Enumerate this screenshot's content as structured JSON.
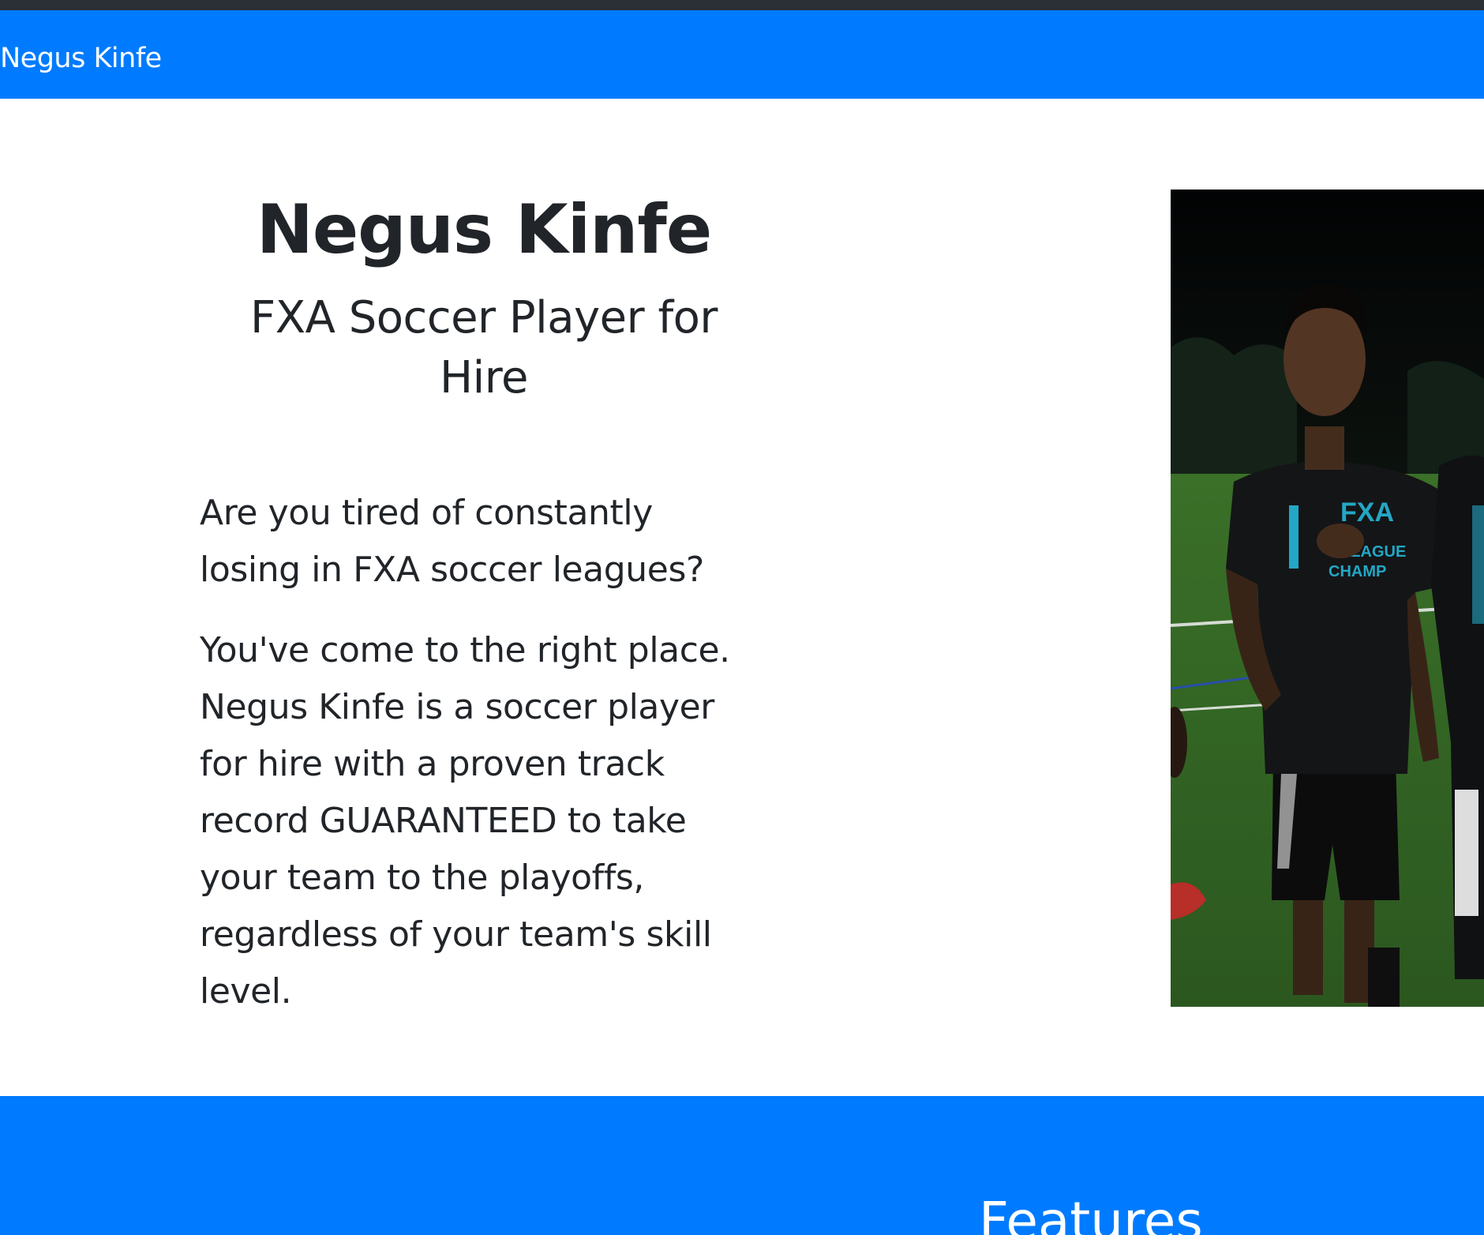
{
  "navbar": {
    "brand": "Negus Kinfe"
  },
  "hero": {
    "title": "Negus Kinfe",
    "subtitle": "FXA Soccer Player for Hire",
    "paragraphs": [
      "Are you tired of constantly losing in FXA soccer leagues?",
      "You've come to the right place. Negus Kinfe is a soccer player for hire with a proven track record GUARANTEED to take your team to the playoffs, regardless of your team's skill level."
    ]
  },
  "photo": {
    "shirt_text_line1": "FXA",
    "shirt_text_line2": "LEAGUE",
    "shirt_text_line3": "CHAMP"
  },
  "features": {
    "title": "Features"
  },
  "colors": {
    "primary": "#007bff",
    "top_strip": "#2b2f36",
    "text": "#212529",
    "white": "#ffffff"
  }
}
